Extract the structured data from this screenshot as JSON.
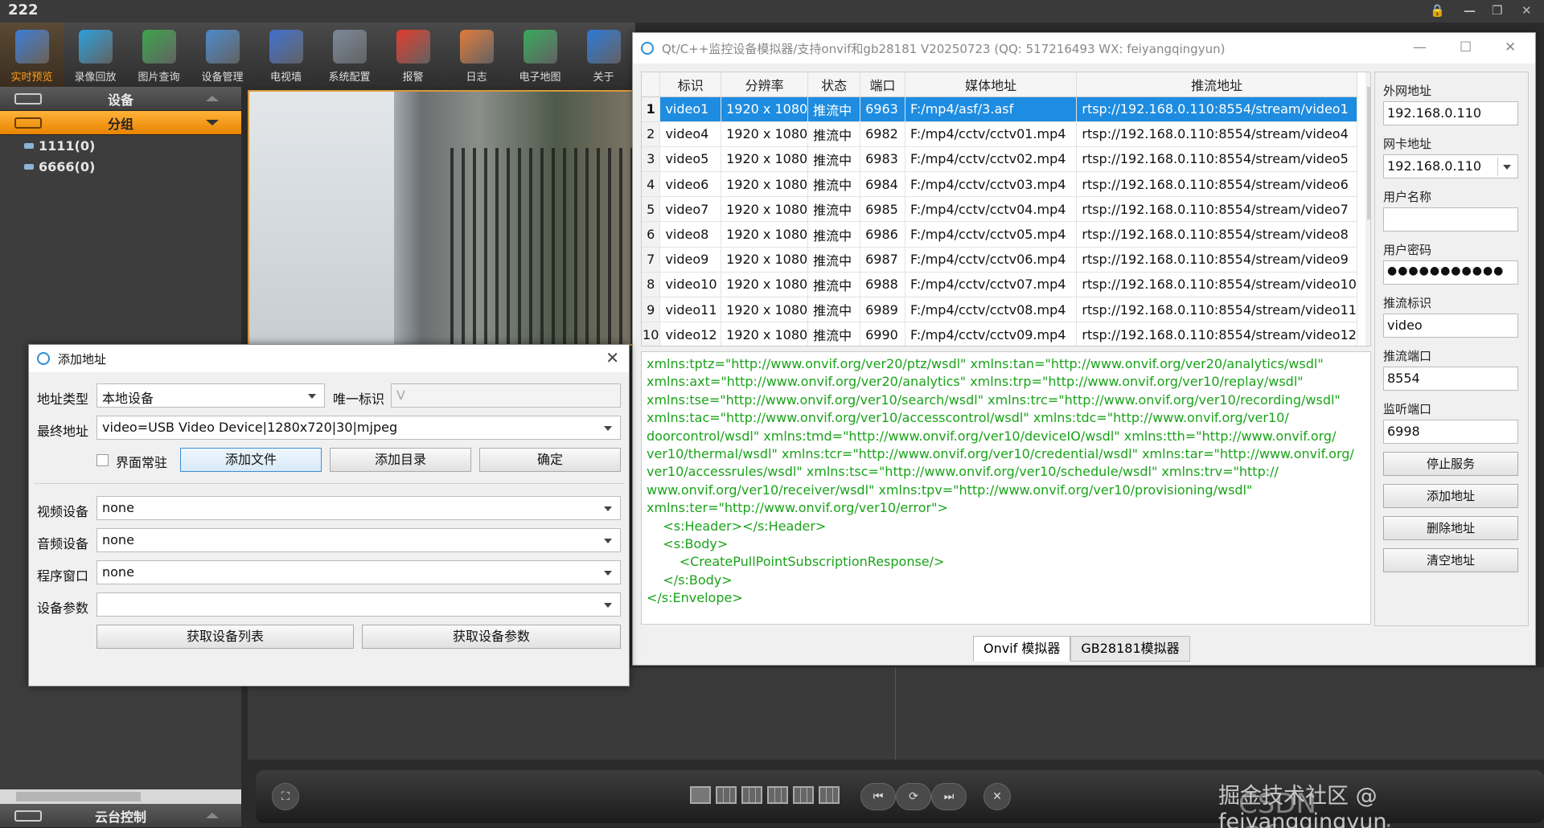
{
  "app": {
    "title": "222"
  },
  "toolbar": [
    {
      "label": "实时预览",
      "icon": "monitor-icon",
      "active": true,
      "color": "#3a7bd5"
    },
    {
      "label": "录像回放",
      "icon": "playback-icon",
      "active": false,
      "color": "#2a9fd8"
    },
    {
      "label": "图片查询",
      "icon": "picture-icon",
      "active": false,
      "color": "#3aa34a"
    },
    {
      "label": "设备管理",
      "icon": "device-icon",
      "active": false,
      "color": "#4b88c9"
    },
    {
      "label": "电视墙",
      "icon": "tvwall-icon",
      "active": false,
      "color": "#3f6fd0"
    },
    {
      "label": "系统配置",
      "icon": "config-icon",
      "active": false,
      "color": "#7a8798"
    },
    {
      "label": "报警",
      "icon": "alarm-icon",
      "active": false,
      "color": "#e03a2a"
    },
    {
      "label": "日志",
      "icon": "log-icon",
      "active": false,
      "color": "#e07a3a"
    },
    {
      "label": "电子地图",
      "icon": "map-icon",
      "active": false,
      "color": "#35a85a"
    },
    {
      "label": "关于",
      "icon": "about-icon",
      "active": false,
      "color": "#2a78d8"
    }
  ],
  "leftpanel": {
    "device_header": "设备",
    "group_header": "分组",
    "tree": [
      "1111(0)",
      "6666(0)"
    ],
    "ptz_header": "云台控制"
  },
  "sim": {
    "title": "Qt/C++监控设备模拟器/支持onvif和gb28181 V20250723 (QQ: 517216493 WX: feiyangqingyun)",
    "columns": [
      "标识",
      "分辨率",
      "状态",
      "端口",
      "媒体地址",
      "推流地址"
    ],
    "rows": [
      {
        "n": "1",
        "id": "video1",
        "res": "1920 x 1080",
        "state": "推流中",
        "port": "6963",
        "media": "F:/mp4/asf/3.asf",
        "push": "rtsp://192.168.0.110:8554/stream/video1",
        "selected": true
      },
      {
        "n": "2",
        "id": "video4",
        "res": "1920 x 1080",
        "state": "推流中",
        "port": "6982",
        "media": "F:/mp4/cctv/cctv01.mp4",
        "push": "rtsp://192.168.0.110:8554/stream/video4"
      },
      {
        "n": "3",
        "id": "video5",
        "res": "1920 x 1080",
        "state": "推流中",
        "port": "6983",
        "media": "F:/mp4/cctv/cctv02.mp4",
        "push": "rtsp://192.168.0.110:8554/stream/video5"
      },
      {
        "n": "4",
        "id": "video6",
        "res": "1920 x 1080",
        "state": "推流中",
        "port": "6984",
        "media": "F:/mp4/cctv/cctv03.mp4",
        "push": "rtsp://192.168.0.110:8554/stream/video6"
      },
      {
        "n": "5",
        "id": "video7",
        "res": "1920 x 1080",
        "state": "推流中",
        "port": "6985",
        "media": "F:/mp4/cctv/cctv04.mp4",
        "push": "rtsp://192.168.0.110:8554/stream/video7"
      },
      {
        "n": "6",
        "id": "video8",
        "res": "1920 x 1080",
        "state": "推流中",
        "port": "6986",
        "media": "F:/mp4/cctv/cctv05.mp4",
        "push": "rtsp://192.168.0.110:8554/stream/video8"
      },
      {
        "n": "7",
        "id": "video9",
        "res": "1920 x 1080",
        "state": "推流中",
        "port": "6987",
        "media": "F:/mp4/cctv/cctv06.mp4",
        "push": "rtsp://192.168.0.110:8554/stream/video9"
      },
      {
        "n": "8",
        "id": "video10",
        "res": "1920 x 1080",
        "state": "推流中",
        "port": "6988",
        "media": "F:/mp4/cctv/cctv07.mp4",
        "push": "rtsp://192.168.0.110:8554/stream/video10"
      },
      {
        "n": "9",
        "id": "video11",
        "res": "1920 x 1080",
        "state": "推流中",
        "port": "6989",
        "media": "F:/mp4/cctv/cctv08.mp4",
        "push": "rtsp://192.168.0.110:8554/stream/video11"
      },
      {
        "n": "10",
        "id": "video12",
        "res": "1920 x 1080",
        "state": "推流中",
        "port": "6990",
        "media": "F:/mp4/cctv/cctv09.mp4",
        "push": "rtsp://192.168.0.110:8554/stream/video12"
      }
    ],
    "xml": [
      "xmlns:tptz=\"http://www.onvif.org/ver20/ptz/wsdl\" xmlns:tan=\"http://www.onvif.org/ver20/analytics/wsdl\"",
      "xmlns:axt=\"http://www.onvif.org/ver20/analytics\" xmlns:trp=\"http://www.onvif.org/ver10/replay/wsdl\"",
      "xmlns:tse=\"http://www.onvif.org/ver10/search/wsdl\" xmlns:trc=\"http://www.onvif.org/ver10/recording/wsdl\"",
      "xmlns:tac=\"http://www.onvif.org/ver10/accesscontrol/wsdl\" xmlns:tdc=\"http://www.onvif.org/ver10/",
      "doorcontrol/wsdl\" xmlns:tmd=\"http://www.onvif.org/ver10/deviceIO/wsdl\" xmlns:tth=\"http://www.onvif.org/",
      "ver10/thermal/wsdl\" xmlns:tcr=\"http://www.onvif.org/ver10/credential/wsdl\" xmlns:tar=\"http://www.onvif.org/",
      "ver10/accessrules/wsdl\" xmlns:tsc=\"http://www.onvif.org/ver10/schedule/wsdl\" xmlns:trv=\"http://",
      "www.onvif.org/ver10/receiver/wsdl\" xmlns:tpv=\"http://www.onvif.org/ver10/provisioning/wsdl\"",
      "xmlns:ter=\"http://www.onvif.org/ver10/error\">",
      "    <s:Header></s:Header>",
      "    <s:Body>",
      "        <CreatePullPointSubscriptionResponse/>",
      "    </s:Body>",
      "</s:Envelope>"
    ],
    "right": {
      "wan_label": "外网地址",
      "wan_value": "192.168.0.110",
      "nic_label": "网卡地址",
      "nic_value": "192.168.0.110",
      "user_label": "用户名称",
      "user_value": "",
      "pwd_label": "用户密码",
      "pwd_value": "●●●●●●●●●●●",
      "push_id_label": "推流标识",
      "push_id_value": "video",
      "push_port_label": "推流端口",
      "push_port_value": "8554",
      "listen_port_label": "监听端口",
      "listen_port_value": "6998",
      "btn_stop": "停止服务",
      "btn_add": "添加地址",
      "btn_del": "删除地址",
      "btn_clear": "清空地址"
    },
    "tabs": [
      "Onvif 模拟器",
      "GB28181模拟器"
    ]
  },
  "dialog": {
    "title": "添加地址",
    "addr_type_label": "地址类型",
    "addr_type_value": "本地设备",
    "uid_label": "唯一标识",
    "uid_value": "V",
    "final_label": "最终地址",
    "final_value": "video=USB Video Device|1280x720|30|mjpeg",
    "pin_label": "界面常驻",
    "btn_add_file": "添加文件",
    "btn_add_dir": "添加目录",
    "btn_ok": "确定",
    "video_dev_label": "视频设备",
    "video_dev_value": "none",
    "audio_dev_label": "音频设备",
    "audio_dev_value": "none",
    "prog_win_label": "程序窗口",
    "prog_win_value": "none",
    "dev_param_label": "设备参数",
    "dev_param_value": "",
    "btn_get_list": "获取设备列表",
    "btn_get_param": "获取设备参数"
  },
  "watermark": {
    "juejin": "掘金技术社区 @ feiyangqingyun",
    "csdn": "CSDN @feiyangqingyun"
  }
}
